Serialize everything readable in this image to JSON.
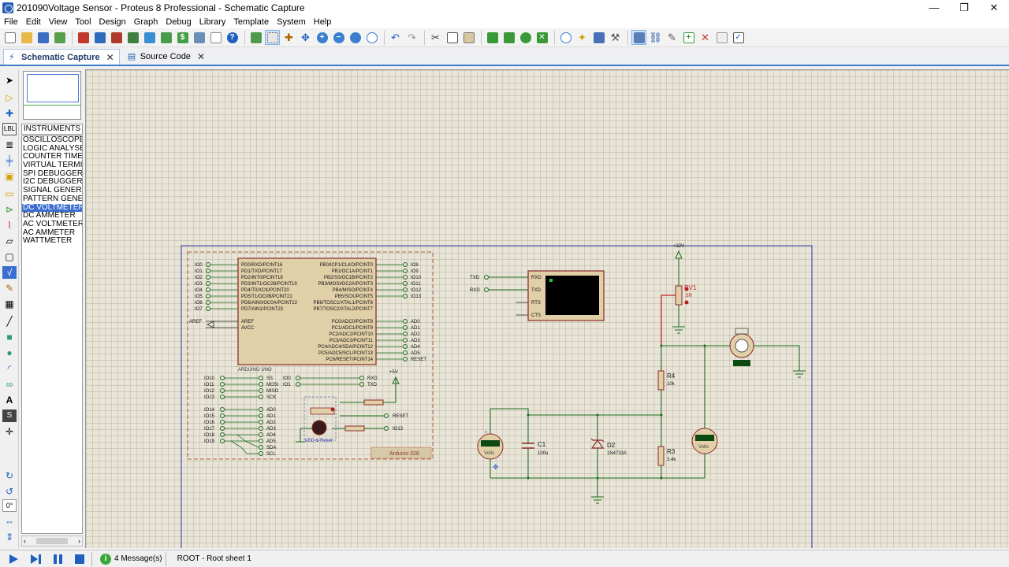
{
  "window": {
    "title": "201090Voltage Sensor - Proteus 8 Professional - Schematic Capture",
    "minimize": "—",
    "maximize": "❐",
    "close": "✕"
  },
  "menu": [
    "File",
    "Edit",
    "View",
    "Tool",
    "Design",
    "Graph",
    "Debug",
    "Library",
    "Template",
    "System",
    "Help"
  ],
  "tabs": [
    {
      "label": "Schematic Capture",
      "close": "✕",
      "active": true
    },
    {
      "label": "Source Code",
      "close": "✕",
      "active": false
    }
  ],
  "objects": {
    "header": "INSTRUMENTS",
    "items": [
      "OSCILLOSCOPE",
      "LOGIC ANALYSER",
      "COUNTER TIMER",
      "VIRTUAL TERMIN",
      "SPI DEBUGGER",
      "I2C DEBUGGER",
      "SIGNAL GENERAT",
      "PATTERN GENERAT",
      "DC VOLTMETER",
      "DC AMMETER",
      "AC VOLTMETER",
      "AC AMMETER",
      "WATTMETER"
    ],
    "selected": "DC VOLTMETER",
    "rotation": "0°"
  },
  "status": {
    "messages": "4 Message(s)",
    "sheet": "ROOT - Root sheet 1"
  },
  "schematic": {
    "arduino": {
      "pins_left": [
        "IO0",
        "IO1",
        "IO2",
        "IO3",
        "IO4",
        "IO5",
        "IO6",
        "IO7"
      ],
      "port_d": [
        "PD0/RXD/PCINT16",
        "PD1/TXD/PCINT17",
        "PD2/INT0/PCINT18",
        "PD3/INT1/OC2B/PCINT19",
        "PD4/T0/XCK/PCINT20",
        "PD5/T1/OC0B/PCINT21",
        "PD6/AIN0/OC0A/PCINT22",
        "PD7/AIN1/PCINT23"
      ],
      "port_b": [
        "PB0/ICP1/CLKO/PCINT0",
        "PB1/OC1A/PCINT1",
        "PB2/SS/OC1B/PCINT2",
        "PB3/MOSI/OC2A/PCINT3",
        "PB4/MISO/PCINT4",
        "PB5/SCK/PCINT5",
        "PB6/TOSC1/XTAL1/PCINT6",
        "PB7/TOSC2/XTAL2/PCINT7"
      ],
      "pins_right": [
        "IO8",
        "IO9",
        "IO10",
        "IO11",
        "IO12",
        "IO13"
      ],
      "aref_left": [
        "AREF"
      ],
      "aref_inner": [
        "AREF",
        "AVCC"
      ],
      "port_c": [
        "PC0/ADC0/PCINT8",
        "PC1/ADC1/PCINT9",
        "PC2/ADC2/PCINT10",
        "PC3/ADC3/PCINT11",
        "PC4/ADC4/SDA/PCINT12",
        "PC5/ADC5/SCL/PCINT13",
        "PC6/RESET/PCINT14"
      ],
      "pins_analog": [
        "AD0",
        "AD1",
        "AD2",
        "AD3",
        "AD4",
        "AD5",
        "RESET"
      ],
      "chip_label": "ARDUINO UNO",
      "spi_left": [
        "IO10",
        "IO11",
        "IO12",
        "IO13"
      ],
      "spi_right": [
        "SS",
        "MOSI",
        "MISO",
        "SCK"
      ],
      "uart_left": [
        "IO0",
        "IO1"
      ],
      "uart_right": [
        "RXD",
        "TXD"
      ],
      "supply": "+5V",
      "reset_net": "RESET",
      "io13_net": "IO13",
      "an_left": [
        "IO14",
        "IO15",
        "IO16",
        "IO17",
        "IO18",
        "IO19"
      ],
      "an_right": [
        "AD0",
        "AD1",
        "AD2",
        "AD3",
        "AD4",
        "AD5",
        "SDA",
        "SCL"
      ],
      "led_reset": "LED & Reset",
      "board_label": "Arduino 328"
    },
    "terminal": {
      "nets": [
        "TXD",
        "RXD"
      ],
      "pins": [
        "RXD",
        "TXD",
        "RTS",
        "CTS"
      ]
    },
    "supply": "+32V",
    "rv1": {
      "name": "RV1",
      "value": "5R"
    },
    "r4": {
      "name": "R4",
      "value": "10k"
    },
    "r3": {
      "name": "R3",
      "value": "3.4k"
    },
    "c1": {
      "name": "C1",
      "value": "100u"
    },
    "d2": {
      "name": "D2",
      "value": "1N4733A"
    },
    "volts": "Volts"
  }
}
